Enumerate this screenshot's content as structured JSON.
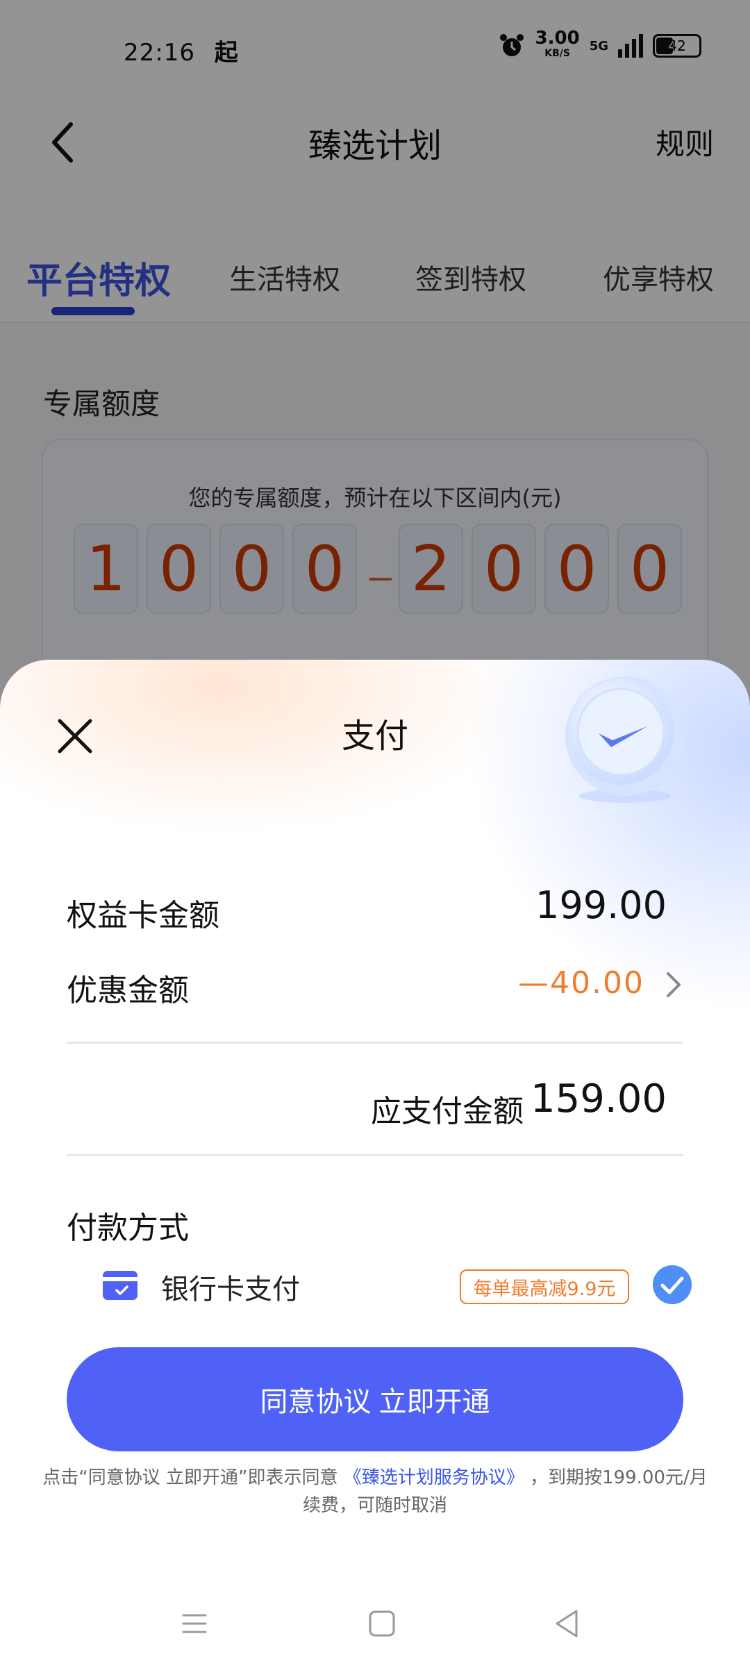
{
  "status_bar": {
    "time": "22:16",
    "time_suffix": "起",
    "net_speed": "3.00",
    "net_unit": "KB/S",
    "network": "5G",
    "battery": "42"
  },
  "nav": {
    "title": "臻选计划",
    "rule_label": "规则"
  },
  "tabs": [
    {
      "label": "平台特权",
      "active": true
    },
    {
      "label": "生活特权",
      "active": false
    },
    {
      "label": "签到特权",
      "active": false
    },
    {
      "label": "优享特权",
      "active": false
    }
  ],
  "quota": {
    "section_title": "专属额度",
    "description": "您的专属额度，预计在以下区间内(元)",
    "low_digits": [
      "1",
      "0",
      "0",
      "0"
    ],
    "high_digits": [
      "2",
      "0",
      "0",
      "0"
    ]
  },
  "payment_sheet": {
    "title": "支付",
    "card_amount_label": "权益卡金额",
    "card_amount": "199.00",
    "discount_label": "优惠金额",
    "discount_amount": "—40.00",
    "payable_label": "应支付金额",
    "payable_amount": "159.00",
    "method_title": "付款方式",
    "method_label": "银行卡支付",
    "method_promo": "每单最高减9.9元",
    "method_selected": true,
    "cta_label": "同意协议 立即开通",
    "agreement_prefix": "点击“同意协议 立即开通”即表示同意",
    "agreement_link": "《臻选计划服务协议》",
    "agreement_suffix": "，到期按199.00元/月续费，可随时取消"
  },
  "colors": {
    "accent": "#4f62f5",
    "tab_active": "#3f55e0",
    "discount": "#f07c2c",
    "digit": "#cf3b05",
    "check": "#4f8ef7"
  },
  "icons": {
    "back": "chevron-left-icon",
    "close": "close-icon",
    "badge": "check-badge-icon",
    "chevron": "chevron-right-icon",
    "bank": "bank-card-icon",
    "selected": "check-circle-icon",
    "sys_menu": "menu-icon",
    "sys_home": "home-icon",
    "sys_back": "back-triangle-icon"
  }
}
